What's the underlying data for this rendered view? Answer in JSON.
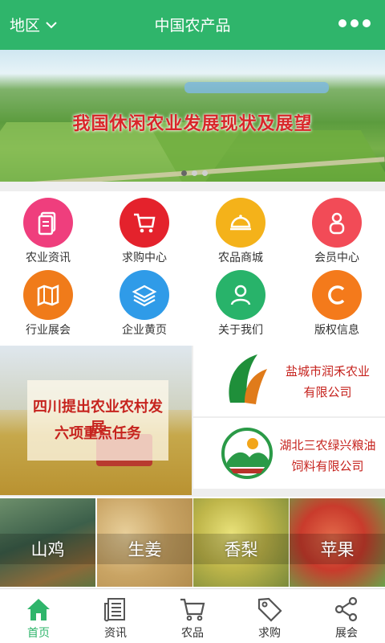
{
  "header": {
    "region_label": "地区",
    "title": "中国农产品",
    "more_icon": "more-dots-icon",
    "color": "#2fb56b"
  },
  "banner": {
    "headline": "我国休闲农业发展现状及展望",
    "slide_count": 3,
    "active_slide": 1
  },
  "categories": [
    {
      "label": "农业资讯",
      "icon": "document-icon",
      "color": "#ef3e7d"
    },
    {
      "label": "求购中心",
      "icon": "cart-icon",
      "color": "#e4222c"
    },
    {
      "label": "农品商城",
      "icon": "cloche-icon",
      "color": "#f4b21a"
    },
    {
      "label": "会员中心",
      "icon": "person-icon",
      "color": "#f24b57"
    },
    {
      "label": "行业展会",
      "icon": "map-book-icon",
      "color": "#f07b1a"
    },
    {
      "label": "企业黄页",
      "icon": "layers-icon",
      "color": "#2f9be8"
    },
    {
      "label": "关于我们",
      "icon": "user-chat-icon",
      "color": "#28b36a"
    },
    {
      "label": "版权信息",
      "icon": "copyright-c-icon",
      "color": "#f47a1b"
    }
  ],
  "featured_news": {
    "line1": "四川提出农业农村发展",
    "line2": "六项重点任务"
  },
  "companies": [
    {
      "line1": "盐城市润禾农业",
      "line2": "有限公司",
      "logo": "leaf-logo-icon"
    },
    {
      "line1": "湖北三农绿兴粮油",
      "line2": "饲料有限公司",
      "logo": "hills-logo-icon"
    }
  ],
  "products": [
    {
      "label": "山鸡"
    },
    {
      "label": "生姜"
    },
    {
      "label": "香梨"
    },
    {
      "label": "苹果"
    }
  ],
  "tabs": [
    {
      "label": "首页",
      "icon": "home-icon",
      "active": true
    },
    {
      "label": "资讯",
      "icon": "news-icon",
      "active": false
    },
    {
      "label": "农品",
      "icon": "cart-icon",
      "active": false
    },
    {
      "label": "求购",
      "icon": "tag-icon",
      "active": false
    },
    {
      "label": "展会",
      "icon": "share-icon",
      "active": false
    }
  ]
}
